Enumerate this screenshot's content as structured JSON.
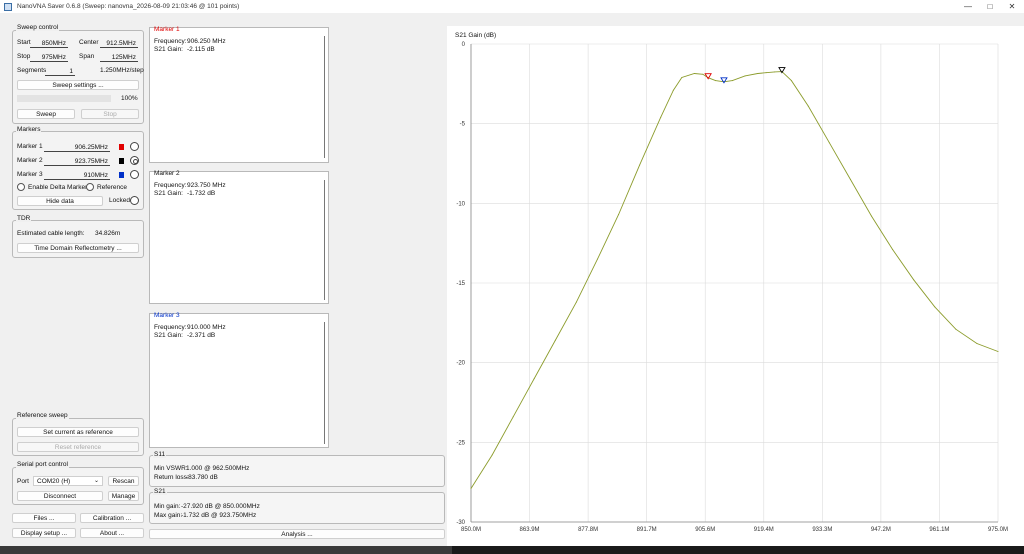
{
  "window": {
    "title": "NanoVNA Saver 0.6.8 (Sweep: nanovna_2026-08-09 21:03:46 @ 101 points)",
    "minimize_glyph": "—",
    "maximize_glyph": "□",
    "close_glyph": "✕"
  },
  "sweep_control": {
    "title": "Sweep control",
    "start_label": "Start",
    "start_value": "850MHz",
    "center_label": "Center",
    "center_value": "912.5MHz",
    "stop_label": "Stop",
    "stop_value": "975MHz",
    "span_label": "Span",
    "span_value": "125MHz",
    "segments_label": "Segments",
    "segments_value": "1",
    "step_text": "1.250MHz/step",
    "settings_button": "Sweep settings ...",
    "progress_text": "100%",
    "progress_value": 100,
    "sweep_button": "Sweep",
    "stop_button": "Stop"
  },
  "markers": {
    "title": "Markers",
    "items": [
      {
        "label": "Marker 1",
        "value": "906.25MHz",
        "color": "#e00000"
      },
      {
        "label": "Marker 2",
        "value": "923.75MHz",
        "color": "#000000"
      },
      {
        "label": "Marker 3",
        "value": "910MHz",
        "color": "#0030c8"
      }
    ],
    "enable_delta": "Enable Delta Marker",
    "reference": "Reference",
    "hide_data_button": "Hide data",
    "locked": "Locked"
  },
  "tdr": {
    "title": "TDR",
    "estimated_text": "Estimated cable length:",
    "estimated_value": "34.826m",
    "button": "Time Domain Reflectometry ..."
  },
  "reference_sweep": {
    "title": "Reference sweep",
    "set_button": "Set current as reference",
    "reset_button": "Reset reference"
  },
  "serial": {
    "title": "Serial port control",
    "port_label": "Port",
    "port_value": "COM20 (H)",
    "rescan_button": "Rescan",
    "disconnect_button": "Disconnect",
    "manage_button": "Manage"
  },
  "bottom_buttons": {
    "files": "Files ...",
    "calibration": "Calibration ...",
    "display_setup": "Display setup ...",
    "about": "About ...",
    "analysis": "Analysis ..."
  },
  "marker_panels": [
    {
      "title": "Marker 1",
      "title_color": "#e00000",
      "freq_label": "Frequency:",
      "freq": "906.250 MHz",
      "gain_label": "S21 Gain:",
      "gain": "-2.115 dB"
    },
    {
      "title": "Marker 2",
      "title_color": "#333333",
      "freq_label": "Frequency:",
      "freq": "923.750 MHz",
      "gain_label": "S21 Gain:",
      "gain": "-1.732 dB"
    },
    {
      "title": "Marker 3",
      "title_color": "#0030c8",
      "freq_label": "Frequency:",
      "freq": "910.000 MHz",
      "gain_label": "S21 Gain:",
      "gain": "-2.371 dB"
    }
  ],
  "s11": {
    "title": "S11",
    "vswr_label": "Min VSWR:",
    "vswr_value": "1.000 @ 962.500MHz",
    "rl_label": "Return loss:",
    "rl_value": "-83.780 dB"
  },
  "s21": {
    "title": "S21",
    "min_label": "Min gain:",
    "min_value": "-27.920 dB @ 850.000MHz",
    "max_label": "Max gain:",
    "max_value": "-1.732 dB @ 923.750MHz"
  },
  "chart_data": {
    "type": "line",
    "title": "S21 Gain (dB)",
    "xlabel": "",
    "ylabel": "",
    "x_unit": "MHz",
    "xlim": [
      850,
      975
    ],
    "ylim": [
      -30,
      0
    ],
    "x_ticks": [
      "850.0M",
      "863.9M",
      "877.8M",
      "891.7M",
      "905.6M",
      "919.4M",
      "933.3M",
      "947.2M",
      "961.1M",
      "975.0M"
    ],
    "y_ticks": [
      "0",
      "-5",
      "-10",
      "-15",
      "-20",
      "-25",
      "-30"
    ],
    "grid": true,
    "line_color": "#8c9c2c",
    "series": [
      {
        "x": [
          850,
          855,
          860,
          865,
          870,
          875,
          880,
          885,
          890,
          895,
          898,
          900,
          903,
          905,
          906.25,
          908,
          910,
          912,
          915,
          918,
          920,
          922,
          923.75,
          926,
          930,
          935,
          940,
          945,
          950,
          955,
          960,
          965,
          970,
          975
        ],
        "y": [
          -27.9,
          -25.8,
          -23.4,
          -21.0,
          -18.6,
          -16.2,
          -13.5,
          -10.7,
          -7.6,
          -4.6,
          -2.9,
          -2.1,
          -1.85,
          -1.9,
          -2.115,
          -2.3,
          -2.371,
          -2.3,
          -2.0,
          -1.85,
          -1.8,
          -1.75,
          -1.732,
          -2.3,
          -3.9,
          -6.2,
          -8.5,
          -10.8,
          -12.9,
          -14.8,
          -16.5,
          -17.9,
          -18.8,
          -19.3
        ]
      }
    ],
    "markers": [
      {
        "x": 906.25,
        "y": -2.115,
        "color": "#e00000"
      },
      {
        "x": 910,
        "y": -2.371,
        "color": "#0030c8"
      },
      {
        "x": 923.75,
        "y": -1.732,
        "color": "#000000"
      }
    ]
  }
}
